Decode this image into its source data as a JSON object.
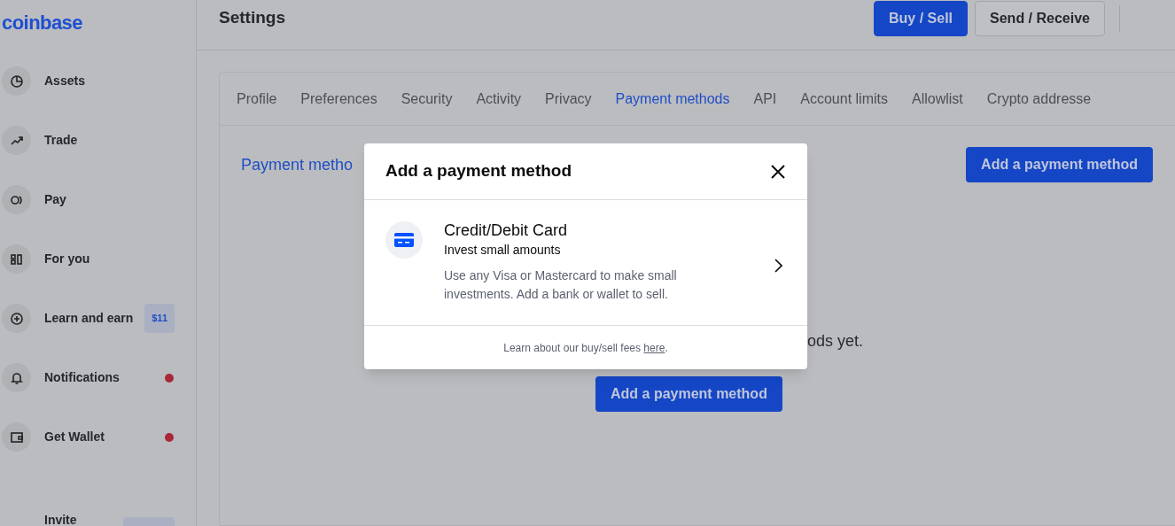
{
  "logo": "coinbase",
  "sidebar": {
    "items": [
      {
        "label": "Assets",
        "dot": false
      },
      {
        "label": "Trade",
        "dot": false
      },
      {
        "label": "Pay",
        "dot": false
      },
      {
        "label": "For you",
        "dot": false
      },
      {
        "label": "Learn and earn",
        "badge": "$11",
        "dot": false
      },
      {
        "label": "Notifications",
        "dot": true
      },
      {
        "label": "Get Wallet",
        "dot": true
      },
      {
        "label": "Invite",
        "dot": false,
        "cut_off": true
      }
    ]
  },
  "header": {
    "title": "Settings",
    "buttons": [
      {
        "label": "Buy / Sell",
        "kind": "primary"
      },
      {
        "label": "Send / Receive",
        "kind": "secondary"
      }
    ]
  },
  "tabs": [
    {
      "label": "Profile",
      "selected": false
    },
    {
      "label": "Preferences",
      "selected": false
    },
    {
      "label": "Security",
      "selected": false
    },
    {
      "label": "Activity",
      "selected": false
    },
    {
      "label": "Privacy",
      "selected": false
    },
    {
      "label": "Payment methods",
      "selected": true
    },
    {
      "label": "API",
      "selected": false
    },
    {
      "label": "Account limits",
      "selected": false
    },
    {
      "label": "Allowlist",
      "selected": false
    },
    {
      "label": "Crypto addresse",
      "selected": false
    }
  ],
  "section": {
    "title": "Payment metho",
    "add_button": "Add a payment method",
    "empty_text": "ods yet.",
    "empty_button": "Add a payment method"
  },
  "modal": {
    "title": "Add a payment method",
    "options": [
      {
        "title": "Credit/Debit Card",
        "subtitle": "Invest small amounts",
        "description": "Use any Visa or Mastercard to make small investments. Add a bank or wallet to sell."
      }
    ],
    "footer_text": "Learn about our buy/sell fees ",
    "footer_link": "here",
    "footer_end": "."
  }
}
